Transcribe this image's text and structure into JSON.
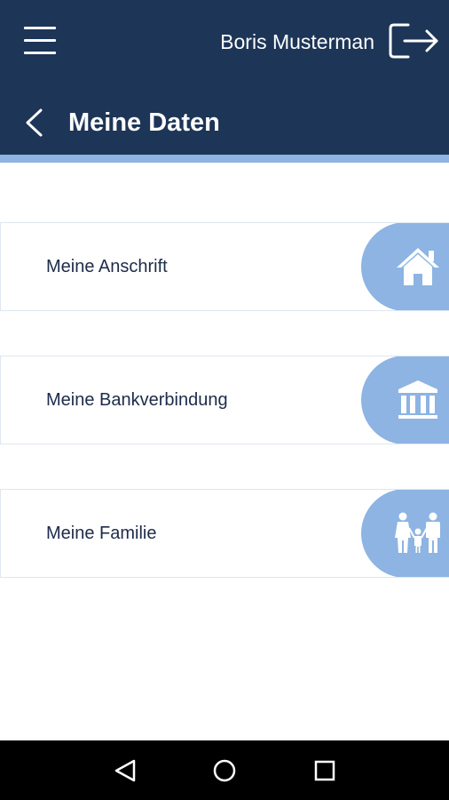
{
  "header": {
    "menu_icon": "hamburger-menu-icon",
    "user_name": "Boris Musterman",
    "logout_icon": "logout-icon",
    "back_icon": "chevron-left-icon",
    "title": "Meine Daten",
    "colors": {
      "header_bg": "#1d3557",
      "accent": "#8db4e2"
    }
  },
  "cards": [
    {
      "label": "Meine Anschrift",
      "icon": "house-icon"
    },
    {
      "label": "Meine Bankverbindung",
      "icon": "bank-icon"
    },
    {
      "label": "Meine Familie",
      "icon": "family-icon"
    }
  ],
  "nav_bar": {
    "back_icon": "triangle-back-icon",
    "home_icon": "circle-home-icon",
    "recents_icon": "square-recents-icon"
  }
}
